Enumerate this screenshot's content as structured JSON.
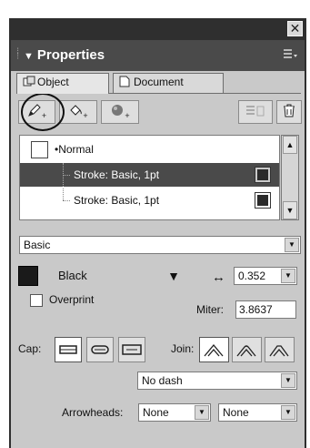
{
  "window": {
    "close_glyph": "✕"
  },
  "panel": {
    "title": "Properties",
    "collapse_glyph": "▼",
    "options_icon": "panel-options-icon"
  },
  "tabs": [
    {
      "label": "Object",
      "icon": "object-icon",
      "active": true
    },
    {
      "label": "Document",
      "icon": "document-icon",
      "active": false
    }
  ],
  "toolbar": {
    "add_stroke": {
      "icon": "pencil-icon",
      "plus": "+"
    },
    "add_fill": {
      "icon": "paint-bucket-icon",
      "plus": "+"
    },
    "add_effect": {
      "icon": "effect-sphere-icon",
      "plus": "+"
    },
    "delete_disabled_icon": "list-delete-icon",
    "trash_icon": "trash-icon"
  },
  "attributes": [
    {
      "label": "Normal",
      "prefix": "•",
      "swatch": "#ffffff"
    },
    {
      "label": "Stroke: Basic, 1pt",
      "swatch": "#2a2a2a",
      "selected": true
    },
    {
      "label": "Stroke: Basic, 1pt",
      "swatch": "#2a2a2a",
      "selected": false
    }
  ],
  "stroke": {
    "type": "Basic",
    "color_name": "Black",
    "color_hex": "#1a1a1a",
    "width": "0.352",
    "overprint_label": "Overprint",
    "overprint_checked": false,
    "miter_label": "Miter:",
    "miter_value": "3.8637",
    "cap_label": "Cap:",
    "join_label": "Join:",
    "dash": "No dash",
    "arrowheads_label": "Arrowheads:",
    "arrow_start": "None",
    "arrow_end": "None"
  },
  "colors": {
    "selection": "#4a4a4a",
    "panel_bg": "#c9c9c9",
    "header_bg": "#4a4a4a"
  }
}
